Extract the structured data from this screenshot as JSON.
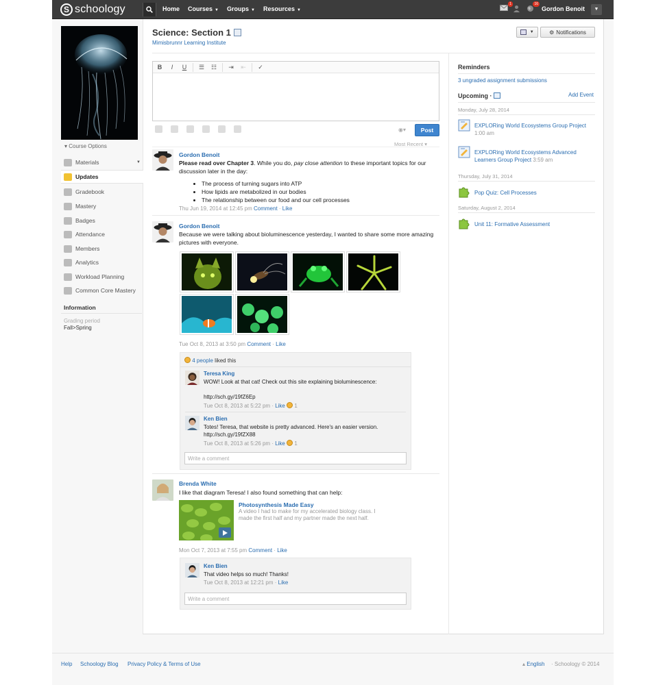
{
  "topbar": {
    "logo_text": "schoology",
    "logo_mark": "S",
    "nav": {
      "home": "Home",
      "courses": "Courses",
      "groups": "Groups",
      "resources": "Resources"
    },
    "messages_count": "1",
    "notifications_count": "16",
    "user_name": "Gordon Benoit"
  },
  "sidebar": {
    "course_options": "Course Options",
    "items": [
      {
        "label": "Materials"
      },
      {
        "label": "Updates"
      },
      {
        "label": "Gradebook"
      },
      {
        "label": "Mastery"
      },
      {
        "label": "Badges"
      },
      {
        "label": "Attendance"
      },
      {
        "label": "Members"
      },
      {
        "label": "Analytics"
      },
      {
        "label": "Workload Planning"
      },
      {
        "label": "Common Core Mastery"
      }
    ],
    "information_heading": "Information",
    "grading_period_label": "Grading period",
    "grading_period_value": "Fall>Spring"
  },
  "header": {
    "course_title": "Science: Section 1",
    "school": "Mimisbrunnr Learning Institute",
    "notifications_button": "Notifications"
  },
  "editor": {
    "toolbar": [
      "B",
      "I",
      "U"
    ],
    "post_button": "Post",
    "sort_label": "Most Recent"
  },
  "posts": [
    {
      "author": "Gordon Benoit",
      "text_bold": "Please read over Chapter 3",
      "text_mid": ". While you do, ",
      "text_em": "pay close attention",
      "text_end": " to these important topics for our discussion later in the day:",
      "bullets": [
        "The process of turning sugars into ATP",
        "How lipids are metabolized in our bodies",
        "The relationship between our food and our cell processes"
      ],
      "date": "Thu Jun 19, 2014 at 12:45 pm",
      "comment": "Comment",
      "like": "Like"
    },
    {
      "author": "Gordon Benoit",
      "text": "Because we were talking about bioluminescence yesterday, I wanted to share some more amazing pictures with everyone.",
      "date": "Tue Oct 8, 2013 at 3:50 pm",
      "comment": "Comment",
      "like": "Like",
      "liked_people": "4 people",
      "liked_suffix": "liked this",
      "comments": [
        {
          "author": "Teresa King",
          "text": "WOW! Look at that cat! Check out this site explaining bioluminescence:",
          "link": "http://sch.gy/19fZ6Ep",
          "date": "Tue Oct 8, 2013 at 5:22 pm",
          "like": "Like",
          "likes": "1"
        },
        {
          "author": "Ken Bien",
          "text": "Totes! Teresa, that website is pretty advanced. Here's an easier version.",
          "link": "http://sch.gy/19fZX88",
          "date": "Tue Oct 8, 2013 at 5:26 pm",
          "like": "Like",
          "likes": "1"
        }
      ],
      "write_comment": "Write a comment"
    },
    {
      "author": "Brenda White",
      "text": "I like that diagram Teresa! I also found something that can help:",
      "video_title": "Photosynthesis Made Easy",
      "video_desc": "A video I had to make for my accelerated biology class. I made the first half and my partner made the next half.",
      "date": "Mon Oct 7, 2013 at 7:55 pm",
      "comment": "Comment",
      "like": "Like",
      "comments": [
        {
          "author": "Ken Bien",
          "text": "That video helps so much! Thanks!",
          "date": "Tue Oct 8, 2013 at 12:21 pm",
          "like": "Like"
        }
      ],
      "write_comment": "Write a comment"
    }
  ],
  "right": {
    "reminders_heading": "Reminders",
    "reminder_link": "3 ungraded assignment submissions",
    "upcoming_heading": "Upcoming",
    "add_event": "Add Event",
    "groups": [
      {
        "date": "Monday, July 28, 2014",
        "events": [
          {
            "title": "EXPLORing World Ecosystems  Group Project",
            "time": "1:00 am"
          },
          {
            "title": "EXPLORing World Ecosystems  Advanced Learners Group Project",
            "time": "3:59 am"
          }
        ]
      },
      {
        "date": "Thursday, July 31, 2014",
        "events": [
          {
            "title": "Pop Quiz: Cell Processes",
            "time": ""
          }
        ]
      },
      {
        "date": "Saturday, August 2, 2014",
        "events": [
          {
            "title": "Unit 11: Formative Assessment",
            "time": ""
          }
        ]
      }
    ]
  },
  "footer": {
    "help": "Help",
    "blog": "Schoology Blog",
    "privacy": "Privacy Policy & Terms of Use",
    "language": "English",
    "copyright": "Schoology © 2014"
  },
  "colors": {
    "topbar": "#3c3c3c",
    "link": "#2a6db0",
    "post_button": "#3f85cf",
    "active_nav": "#f1c232"
  }
}
